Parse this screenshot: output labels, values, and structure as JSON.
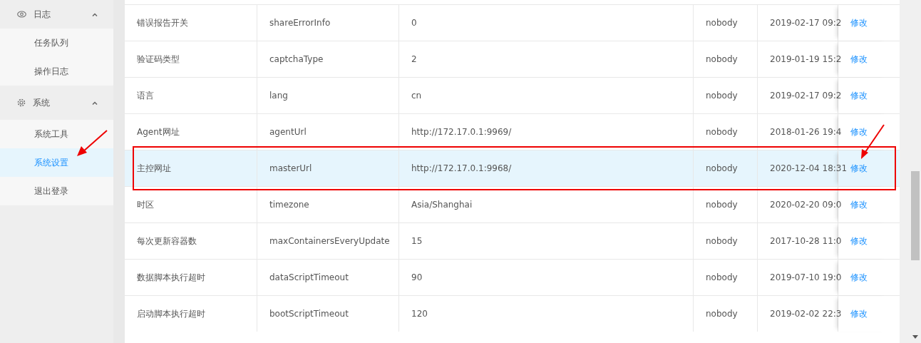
{
  "sidebar": {
    "groups": [
      {
        "label": "日志",
        "kind": "eye",
        "expanded": true,
        "items": [
          {
            "label": "任务队列",
            "selected": false
          },
          {
            "label": "操作日志",
            "selected": false
          }
        ]
      },
      {
        "label": "系统",
        "kind": "gear",
        "expanded": true,
        "items": [
          {
            "label": "系统工具",
            "selected": false
          },
          {
            "label": "系统设置",
            "selected": true
          },
          {
            "label": "退出登录",
            "selected": false
          }
        ]
      }
    ]
  },
  "table": {
    "rows": [
      {
        "name": "错误报告开关",
        "key": "shareErrorInfo",
        "value": "0",
        "user": "nobody",
        "time": "2019-02-17 09:2",
        "action": "修改",
        "selected": false
      },
      {
        "name": "验证码类型",
        "key": "captchaType",
        "value": "2",
        "user": "nobody",
        "time": "2019-01-19 15:2",
        "action": "修改",
        "selected": false
      },
      {
        "name": "语言",
        "key": "lang",
        "value": "cn",
        "user": "nobody",
        "time": "2019-02-17 09:2",
        "action": "修改",
        "selected": false
      },
      {
        "name": "Agent网址",
        "key": "agentUrl",
        "value": "http://172.17.0.1:9969/",
        "user": "nobody",
        "time": "2018-01-26 19:4",
        "action": "修改",
        "selected": false
      },
      {
        "name": "主控网址",
        "key": "masterUrl",
        "value": "http://172.17.0.1:9968/",
        "user": "nobody",
        "time": "2020-12-04 18:31",
        "action": "修改",
        "selected": true
      },
      {
        "name": "时区",
        "key": "timezone",
        "value": "Asia/Shanghai",
        "user": "nobody",
        "time": "2020-02-20 09:0",
        "action": "修改",
        "selected": false
      },
      {
        "name": "每次更新容器数",
        "key": "maxContainersEveryUpdate",
        "value": "15",
        "user": "nobody",
        "time": "2017-10-28 11:0",
        "action": "修改",
        "selected": false
      },
      {
        "name": "数据脚本执行超时",
        "key": "dataScriptTimeout",
        "value": "90",
        "user": "nobody",
        "time": "2019-07-10 19:0",
        "action": "修改",
        "selected": false
      },
      {
        "name": "启动脚本执行超时",
        "key": "bootScriptTimeout",
        "value": "120",
        "user": "nobody",
        "time": "2019-02-02 22:3",
        "action": "修改",
        "selected": false
      }
    ]
  }
}
